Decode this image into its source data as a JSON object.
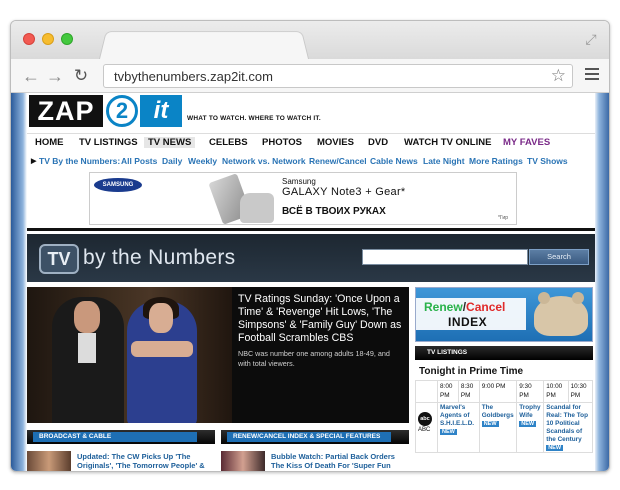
{
  "browser": {
    "url": "tvbythenumbers.zap2it.com"
  },
  "header": {
    "logo": {
      "zap": "ZAP",
      "two": "2",
      "it": "it"
    },
    "tagline": "WHAT TO WATCH. WHERE TO WATCH IT."
  },
  "main_nav": [
    "HOME",
    "TV LISTINGS",
    "TV NEWS",
    "CELEBS",
    "PHOTOS",
    "MOVIES",
    "DVD",
    "WATCH TV ONLINE",
    "MY FAVES"
  ],
  "sub_nav": [
    "TV By the Numbers:",
    "All Posts",
    "Daily",
    "Weekly",
    "Network vs. Network",
    "Renew/Cancel",
    "Cable News",
    "Late Night",
    "More Ratings",
    "TV Shows"
  ],
  "ad": {
    "logo": "SAMSUNG",
    "brand": "Samsung",
    "product": "GALAXY Note3 + Gear*",
    "slogan": "ВСЁ В ТВОИХ РУКАХ",
    "fine_print": "*Гир"
  },
  "site_banner": {
    "icon_text": "TV",
    "title": "by the Numbers",
    "search_button": "Search"
  },
  "hero": {
    "title": "TV Ratings Sunday: 'Once Upon a Time' & 'Revenge' Hit Lows, 'The Simpsons' & 'Family Guy' Down as Football Scrambles CBS",
    "subtitle": "NBC was number one among adults 18-49, and with total viewers."
  },
  "renew_cancel": {
    "word1": "Renew",
    "slash": "/",
    "word2": "Cancel",
    "line2": "INDEX"
  },
  "listings": {
    "header": "TV LISTINGS",
    "title": "Tonight in Prime Time",
    "times": [
      "8:00 PM",
      "8:30 PM",
      "9:00 PM",
      "9:30 PM",
      "10:00 PM",
      "10:30 PM"
    ],
    "network_logo": "abc",
    "network": "ABC",
    "shows": [
      {
        "title": "Marvel's Agents of S.H.I.E.L.D.",
        "badge": "NEW"
      },
      {
        "title": "The Goldbergs",
        "badge": "NEW"
      },
      {
        "title": "Trophy Wife",
        "badge": "NEW"
      },
      {
        "title": "Scandal for Real: The Top 10 Political Scandals of the Century",
        "badge": "NEW"
      }
    ]
  },
  "sections": {
    "left_header": "BROADCAST & CABLE",
    "mid_header": "RENEW/CANCEL INDEX & SPECIAL FEATURES",
    "left_story": "Updated: The CW Picks Up 'The Originals', 'The Tomorrow People' &",
    "mid_story": "Bubble Watch: Partial Back Orders The Kiss Of Death For 'Super Fun Night' &"
  }
}
